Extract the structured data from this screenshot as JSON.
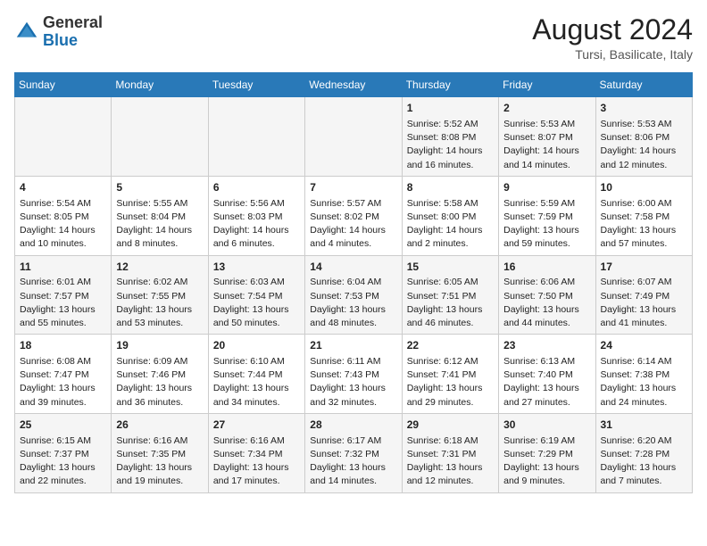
{
  "header": {
    "logo_general": "General",
    "logo_blue": "Blue",
    "month_year": "August 2024",
    "location": "Tursi, Basilicate, Italy"
  },
  "weekdays": [
    "Sunday",
    "Monday",
    "Tuesday",
    "Wednesday",
    "Thursday",
    "Friday",
    "Saturday"
  ],
  "weeks": [
    [
      {
        "day": "",
        "info": ""
      },
      {
        "day": "",
        "info": ""
      },
      {
        "day": "",
        "info": ""
      },
      {
        "day": "",
        "info": ""
      },
      {
        "day": "1",
        "info": "Sunrise: 5:52 AM\nSunset: 8:08 PM\nDaylight: 14 hours and 16 minutes."
      },
      {
        "day": "2",
        "info": "Sunrise: 5:53 AM\nSunset: 8:07 PM\nDaylight: 14 hours and 14 minutes."
      },
      {
        "day": "3",
        "info": "Sunrise: 5:53 AM\nSunset: 8:06 PM\nDaylight: 14 hours and 12 minutes."
      }
    ],
    [
      {
        "day": "4",
        "info": "Sunrise: 5:54 AM\nSunset: 8:05 PM\nDaylight: 14 hours and 10 minutes."
      },
      {
        "day": "5",
        "info": "Sunrise: 5:55 AM\nSunset: 8:04 PM\nDaylight: 14 hours and 8 minutes."
      },
      {
        "day": "6",
        "info": "Sunrise: 5:56 AM\nSunset: 8:03 PM\nDaylight: 14 hours and 6 minutes."
      },
      {
        "day": "7",
        "info": "Sunrise: 5:57 AM\nSunset: 8:02 PM\nDaylight: 14 hours and 4 minutes."
      },
      {
        "day": "8",
        "info": "Sunrise: 5:58 AM\nSunset: 8:00 PM\nDaylight: 14 hours and 2 minutes."
      },
      {
        "day": "9",
        "info": "Sunrise: 5:59 AM\nSunset: 7:59 PM\nDaylight: 13 hours and 59 minutes."
      },
      {
        "day": "10",
        "info": "Sunrise: 6:00 AM\nSunset: 7:58 PM\nDaylight: 13 hours and 57 minutes."
      }
    ],
    [
      {
        "day": "11",
        "info": "Sunrise: 6:01 AM\nSunset: 7:57 PM\nDaylight: 13 hours and 55 minutes."
      },
      {
        "day": "12",
        "info": "Sunrise: 6:02 AM\nSunset: 7:55 PM\nDaylight: 13 hours and 53 minutes."
      },
      {
        "day": "13",
        "info": "Sunrise: 6:03 AM\nSunset: 7:54 PM\nDaylight: 13 hours and 50 minutes."
      },
      {
        "day": "14",
        "info": "Sunrise: 6:04 AM\nSunset: 7:53 PM\nDaylight: 13 hours and 48 minutes."
      },
      {
        "day": "15",
        "info": "Sunrise: 6:05 AM\nSunset: 7:51 PM\nDaylight: 13 hours and 46 minutes."
      },
      {
        "day": "16",
        "info": "Sunrise: 6:06 AM\nSunset: 7:50 PM\nDaylight: 13 hours and 44 minutes."
      },
      {
        "day": "17",
        "info": "Sunrise: 6:07 AM\nSunset: 7:49 PM\nDaylight: 13 hours and 41 minutes."
      }
    ],
    [
      {
        "day": "18",
        "info": "Sunrise: 6:08 AM\nSunset: 7:47 PM\nDaylight: 13 hours and 39 minutes."
      },
      {
        "day": "19",
        "info": "Sunrise: 6:09 AM\nSunset: 7:46 PM\nDaylight: 13 hours and 36 minutes."
      },
      {
        "day": "20",
        "info": "Sunrise: 6:10 AM\nSunset: 7:44 PM\nDaylight: 13 hours and 34 minutes."
      },
      {
        "day": "21",
        "info": "Sunrise: 6:11 AM\nSunset: 7:43 PM\nDaylight: 13 hours and 32 minutes."
      },
      {
        "day": "22",
        "info": "Sunrise: 6:12 AM\nSunset: 7:41 PM\nDaylight: 13 hours and 29 minutes."
      },
      {
        "day": "23",
        "info": "Sunrise: 6:13 AM\nSunset: 7:40 PM\nDaylight: 13 hours and 27 minutes."
      },
      {
        "day": "24",
        "info": "Sunrise: 6:14 AM\nSunset: 7:38 PM\nDaylight: 13 hours and 24 minutes."
      }
    ],
    [
      {
        "day": "25",
        "info": "Sunrise: 6:15 AM\nSunset: 7:37 PM\nDaylight: 13 hours and 22 minutes."
      },
      {
        "day": "26",
        "info": "Sunrise: 6:16 AM\nSunset: 7:35 PM\nDaylight: 13 hours and 19 minutes."
      },
      {
        "day": "27",
        "info": "Sunrise: 6:16 AM\nSunset: 7:34 PM\nDaylight: 13 hours and 17 minutes."
      },
      {
        "day": "28",
        "info": "Sunrise: 6:17 AM\nSunset: 7:32 PM\nDaylight: 13 hours and 14 minutes."
      },
      {
        "day": "29",
        "info": "Sunrise: 6:18 AM\nSunset: 7:31 PM\nDaylight: 13 hours and 12 minutes."
      },
      {
        "day": "30",
        "info": "Sunrise: 6:19 AM\nSunset: 7:29 PM\nDaylight: 13 hours and 9 minutes."
      },
      {
        "day": "31",
        "info": "Sunrise: 6:20 AM\nSunset: 7:28 PM\nDaylight: 13 hours and 7 minutes."
      }
    ]
  ]
}
